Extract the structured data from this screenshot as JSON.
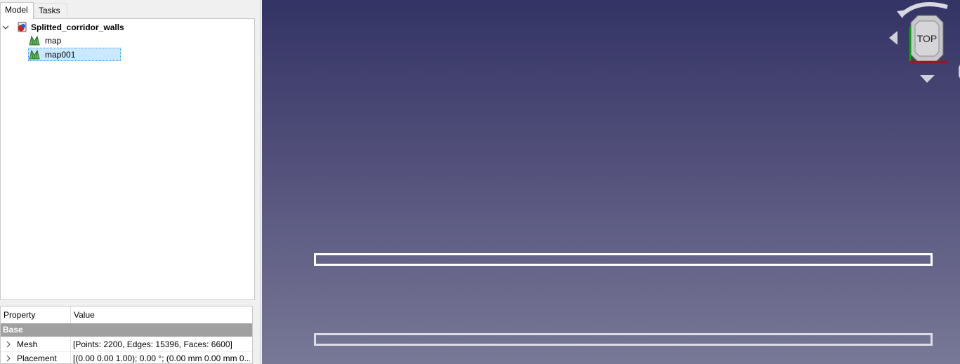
{
  "combo_view": {
    "tabs": [
      {
        "label": "Model",
        "active": true
      },
      {
        "label": "Tasks",
        "active": false
      }
    ],
    "tree": {
      "document": {
        "label": "Splitted_corridor_walls",
        "icon": "freecad-document-icon",
        "expanded": true
      },
      "items": [
        {
          "label": "map",
          "icon": "mesh-icon",
          "selected": false
        },
        {
          "label": "map001",
          "icon": "mesh-icon",
          "selected": true
        }
      ]
    },
    "property_view": {
      "headers": {
        "property": "Property",
        "value": "Value"
      },
      "group": "Base",
      "rows": [
        {
          "name": "Mesh",
          "value": "[Points: 2200, Edges: 15396, Faces: 6600]"
        },
        {
          "name": "Placement",
          "value": "[(0.00 0.00 1.00); 0.00 °; (0.00 mm  0.00 mm  0...."
        }
      ]
    }
  },
  "view3d": {
    "navcube_face": "TOP",
    "background_colors": {
      "top": "#333365",
      "bottom": "#787897"
    },
    "walls": [
      {
        "name": "map001",
        "selected": true,
        "color": "#ffffff"
      },
      {
        "name": "map",
        "selected": false,
        "color": "#dcdce6"
      }
    ]
  },
  "colors": {
    "selection": "#cce8ff",
    "selection_border": "#3399ff",
    "axis_x": "#cc0000",
    "axis_y": "#00aa00"
  }
}
